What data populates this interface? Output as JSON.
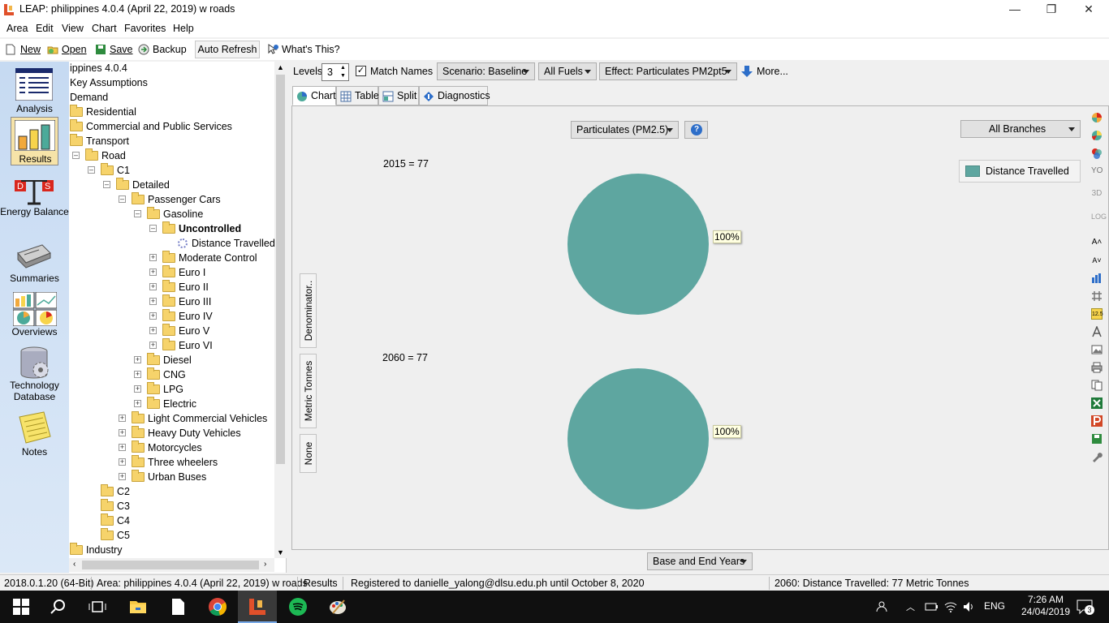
{
  "window": {
    "title": "LEAP: philippines 4.0.4 (April 22, 2019) w roads",
    "minimize": "—",
    "maximize": "❐",
    "close": "✕"
  },
  "menu": [
    "Area",
    "Edit",
    "View",
    "Chart",
    "Favorites",
    "Help"
  ],
  "toolbar": {
    "new": "New",
    "open": "Open",
    "save": "Save",
    "backup": "Backup",
    "auto_refresh": "Auto Refresh",
    "whats_this": "What's This?"
  },
  "sidebar": {
    "items": [
      {
        "label": "Analysis"
      },
      {
        "label": "Results"
      },
      {
        "label": "Energy Balance"
      },
      {
        "label": "Summaries"
      },
      {
        "label": "Overviews"
      },
      {
        "label": "Technology Database"
      },
      {
        "label": "Notes"
      }
    ]
  },
  "tree": {
    "nodes": [
      {
        "label": "ippines 4.0.4"
      },
      {
        "label": "Key Assumptions"
      },
      {
        "label": "Demand"
      },
      {
        "label": "Residential"
      },
      {
        "label": "Commercial and Public Services"
      },
      {
        "label": "Transport"
      },
      {
        "label": "Road"
      },
      {
        "label": "C1"
      },
      {
        "label": "Detailed"
      },
      {
        "label": "Passenger Cars"
      },
      {
        "label": "Gasoline"
      },
      {
        "label": "Uncontrolled"
      },
      {
        "label": "Distance Travelled"
      },
      {
        "label": "Moderate Control"
      },
      {
        "label": "Euro I"
      },
      {
        "label": "Euro II"
      },
      {
        "label": "Euro III"
      },
      {
        "label": "Euro IV"
      },
      {
        "label": "Euro V"
      },
      {
        "label": "Euro VI"
      },
      {
        "label": "Diesel"
      },
      {
        "label": "CNG"
      },
      {
        "label": "LPG"
      },
      {
        "label": "Electric"
      },
      {
        "label": "Light Commercial Vehicles"
      },
      {
        "label": "Heavy Duty Vehicles"
      },
      {
        "label": "Motorcycles"
      },
      {
        "label": "Three wheelers"
      },
      {
        "label": "Urban Buses"
      },
      {
        "label": "C2"
      },
      {
        "label": "C3"
      },
      {
        "label": "C4"
      },
      {
        "label": "C5"
      },
      {
        "label": "Industry"
      }
    ]
  },
  "controls": {
    "levels_label": "Levels:",
    "levels_value": "3",
    "match_names": "Match Names",
    "scenario": "Scenario: Baseline",
    "fuels": "All Fuels",
    "effect": "Effect: Particulates PM2pt5",
    "more": "More...",
    "pollutant": "Particulates (PM2.5)",
    "branches": "All Branches",
    "years": "Base and End Years"
  },
  "tabs": [
    "Chart",
    "Table",
    "Split",
    "Diagnostics"
  ],
  "vertical_tabs": [
    "Denominator..",
    "Metric Tonnes",
    "None"
  ],
  "chart_data": {
    "type": "pie",
    "charts": [
      {
        "label": "2015 = 77",
        "slices": [
          {
            "name": "Distance Travelled",
            "value": 100,
            "label": "100%"
          }
        ]
      },
      {
        "label": "2060 = 77",
        "slices": [
          {
            "name": "Distance Travelled",
            "value": 100,
            "label": "100%"
          }
        ]
      }
    ],
    "legend": [
      "Distance Travelled"
    ],
    "legend_position": "top-right",
    "colors": {
      "Distance Travelled": "#5ea6a0"
    }
  },
  "right_tools": {
    "labels": [
      "YO",
      "3D",
      "LOG",
      "A˄",
      "A˅",
      "12.5"
    ]
  },
  "status": {
    "version": "2018.0.1.20 (64-Bit)",
    "area": "Area: philippines 4.0.4 (April 22, 2019) w roads",
    "view": "Results",
    "registered": "Registered to danielle_yalong@dlsu.edu.ph until October 8, 2020",
    "selection": "2060: Distance Travelled: 77 Metric Tonnes"
  },
  "taskbar": {
    "lang": "ENG",
    "time": "7:26 AM",
    "date": "24/04/2019",
    "notifications": "3"
  }
}
